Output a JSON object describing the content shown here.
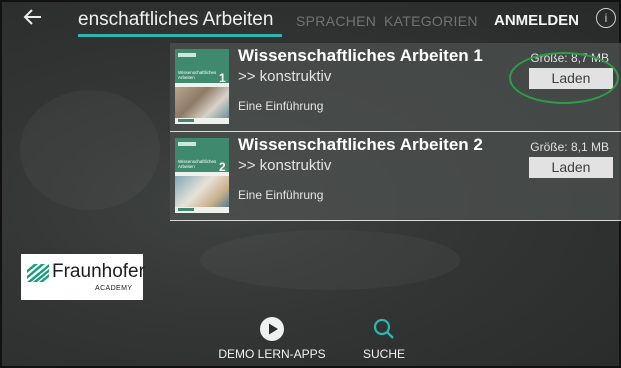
{
  "topbar": {
    "back_icon": "arrow-left-icon",
    "active_tab": "enschaftliches Arbeiten",
    "tab_languages": "SPRACHEN",
    "tab_categories": "KATEGORIEN",
    "login": "ANMELDEN",
    "info_icon": "info-icon",
    "info_glyph": "i",
    "accent_color": "#2fb5aa"
  },
  "items": [
    {
      "title": "Wissenschaftliches Arbeiten 1",
      "subtitle": ">> konstruktiv",
      "description": "Eine Einführung",
      "size": "Größe: 8,7 MB",
      "action": "Laden",
      "cover": {
        "title": "Wissenschaftliches Arbeiten",
        "number": "1"
      }
    },
    {
      "title": "Wissenschaftliches Arbeiten 2",
      "subtitle": ">> konstruktiv",
      "description": "Eine Einführung",
      "size": "Größe: 8,1 MB",
      "action": "Laden",
      "cover": {
        "title": "Wissenschaftliches Arbeiten",
        "number": "2"
      }
    }
  ],
  "logo": {
    "name": "Fraunhofer",
    "sub": "ACADEMY"
  },
  "bottom_nav": [
    {
      "label": "DEMO LERN-APPS",
      "icon": "play-circle-icon"
    },
    {
      "label": "SUCHE",
      "icon": "search-icon",
      "color": "#2fb5aa"
    }
  ]
}
